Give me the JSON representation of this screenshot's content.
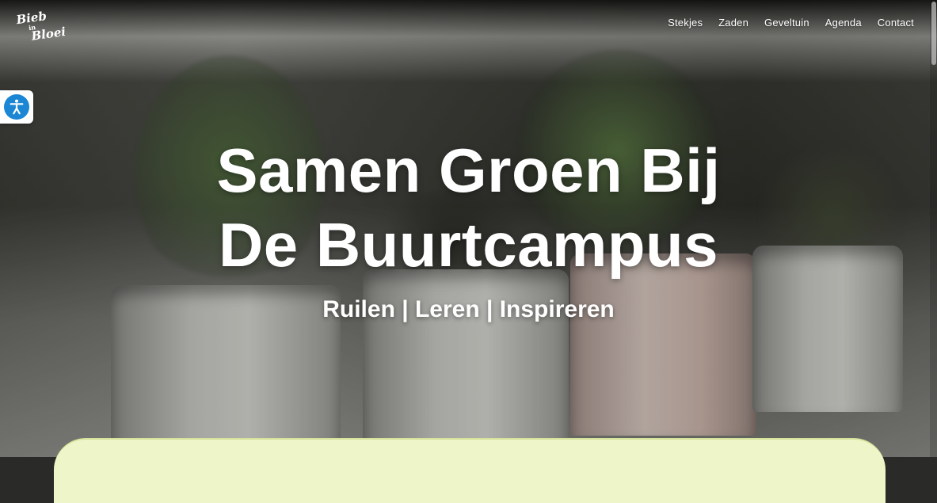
{
  "brand": {
    "logo_top": "Bieb",
    "logo_mid": "in",
    "logo_bottom": "Bloei"
  },
  "nav": {
    "items": [
      "Stekjes",
      "Zaden",
      "Geveltuin",
      "Agenda",
      "Contact"
    ]
  },
  "accessibility": {
    "icon": "accessibility-icon",
    "color": "#1a86d4"
  },
  "hero": {
    "title_line1": "Samen Groen Bij",
    "title_line2": "De Buurtcampus",
    "subtitle": "Ruilen | Leren | Inspireren"
  },
  "colors": {
    "card_bg": "#eef5c8",
    "text": "#ffffff"
  }
}
